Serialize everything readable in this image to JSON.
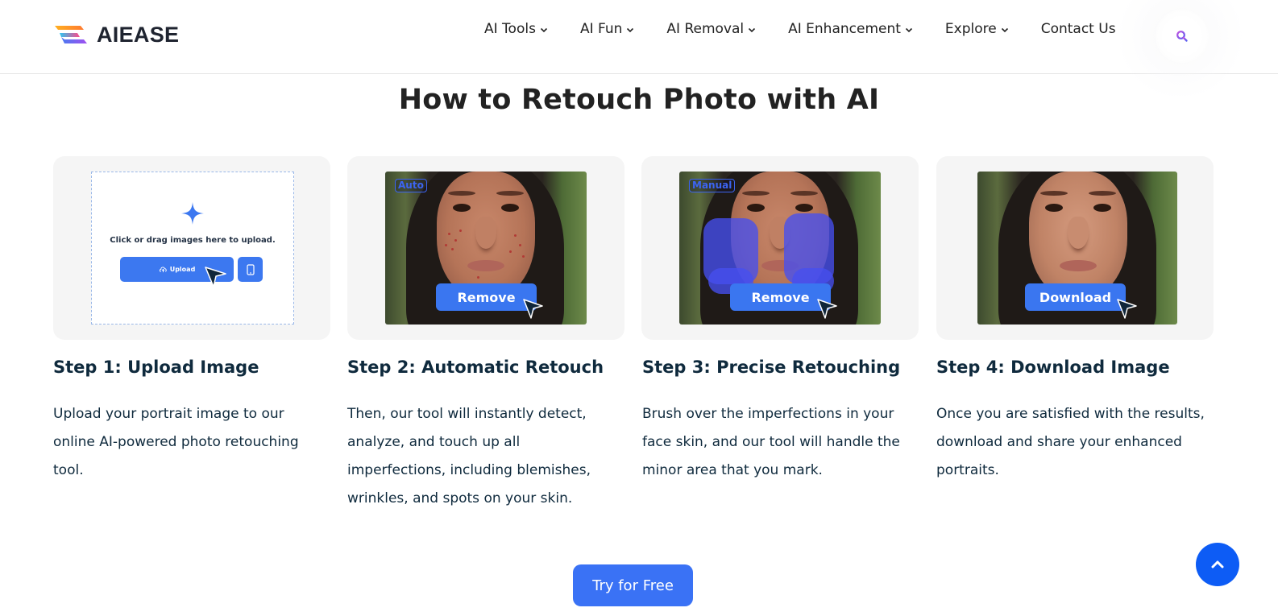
{
  "brand": {
    "name": "AIEASE"
  },
  "nav": {
    "items": [
      {
        "label": "AI Tools",
        "has_dropdown": true
      },
      {
        "label": "AI Fun",
        "has_dropdown": true
      },
      {
        "label": "AI Removal",
        "has_dropdown": true
      },
      {
        "label": "AI Enhancement",
        "has_dropdown": true
      },
      {
        "label": "Explore",
        "has_dropdown": true
      },
      {
        "label": "Contact Us",
        "has_dropdown": false
      }
    ],
    "search_icon": "search-icon"
  },
  "section": {
    "title": "How to Retouch Photo with AI"
  },
  "steps": [
    {
      "title": "Step 1: Upload Image",
      "description": "Upload your portrait image to our online AI-powered photo retouching tool.",
      "illustration": {
        "hint": "Click or drag images here to upload.",
        "upload_label": "Upload"
      }
    },
    {
      "title": "Step 2: Automatic Retouch",
      "description": "Then, our tool will instantly detect, analyze, and touch up all imperfections, including blemishes, wrinkles, and spots on your skin.",
      "illustration": {
        "tag": "Auto",
        "button_label": "Remove"
      }
    },
    {
      "title": "Step 3: Precise Retouching",
      "description": "Brush over the imperfections in your face skin, and our tool will handle the minor area that you mark.",
      "illustration": {
        "tag": "Manual",
        "button_label": "Remove"
      }
    },
    {
      "title": "Step 4: Download Image",
      "description": "Once you are satisfied with the results, download and share your enhanced portraits.",
      "illustration": {
        "button_label": "Download"
      }
    }
  ],
  "cta": {
    "label": "Try for Free"
  },
  "colors": {
    "accent": "#3a72f5",
    "scroll_top": "#0d5cf5",
    "heading": "#0f2a3d",
    "card_bg": "#f5f5f5"
  }
}
